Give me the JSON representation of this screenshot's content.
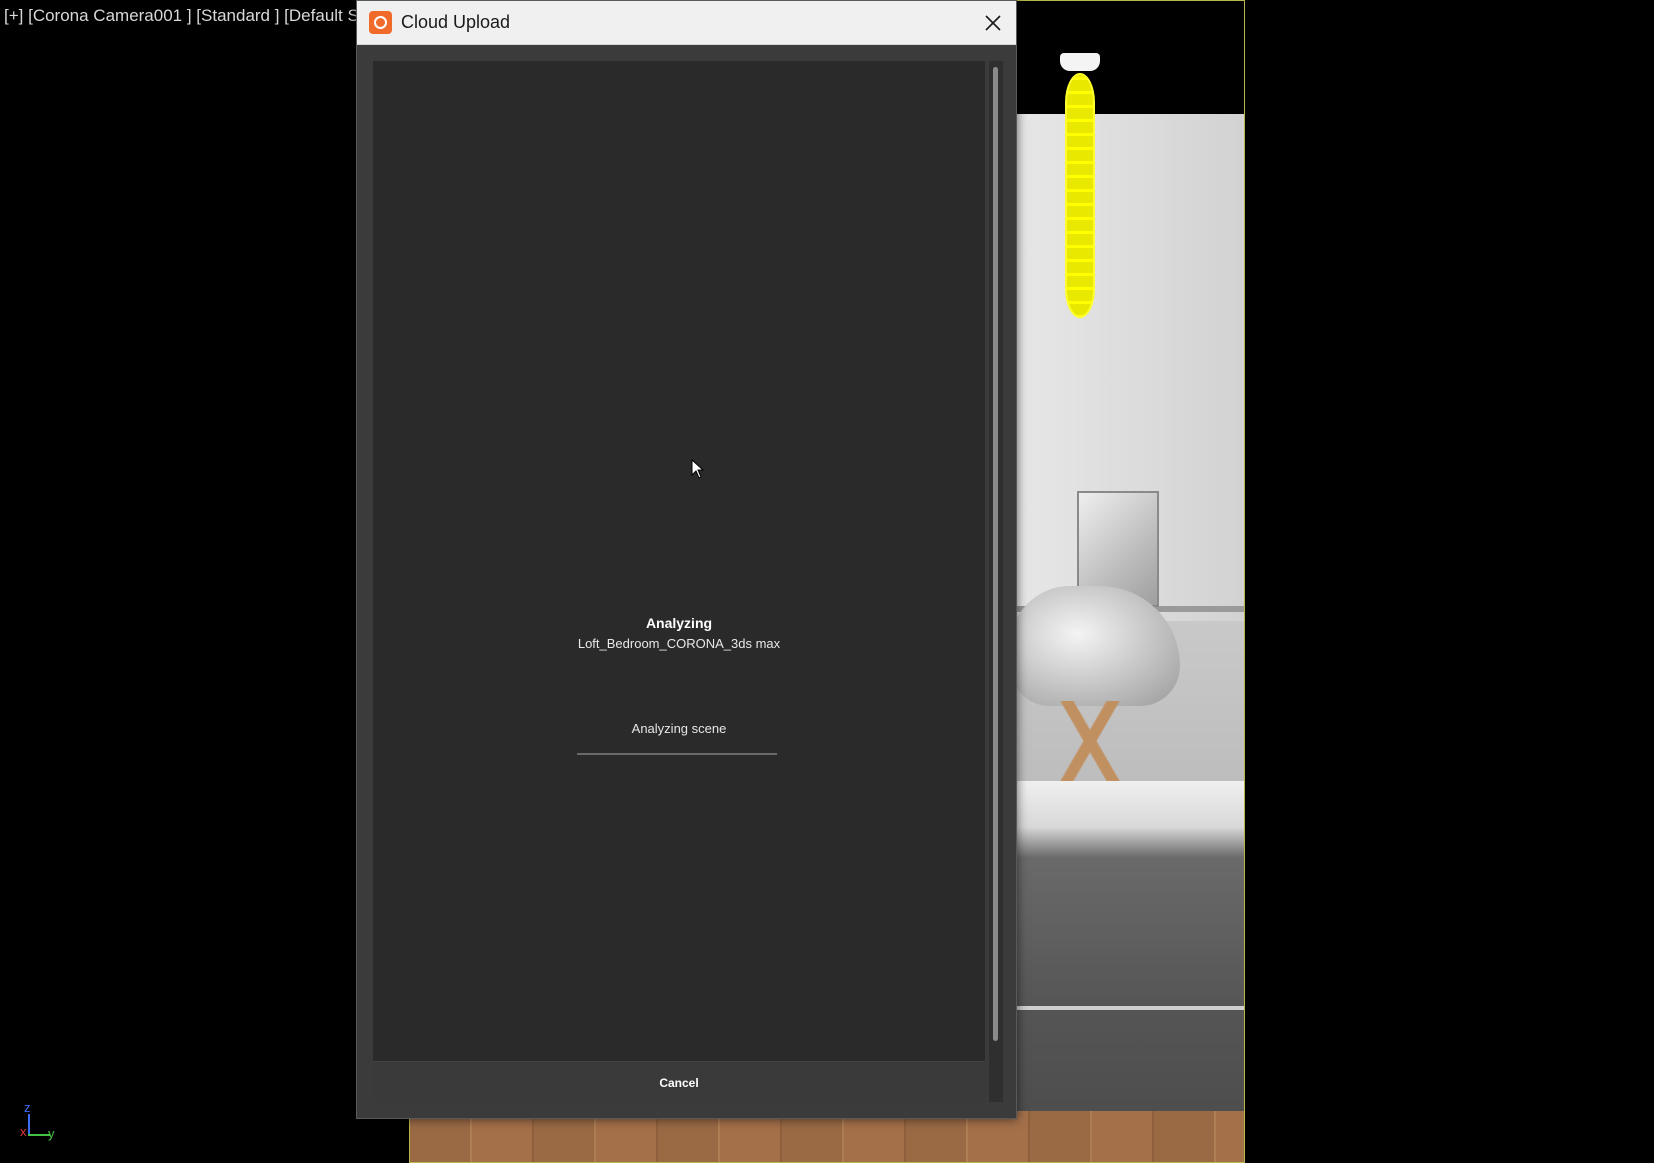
{
  "viewport": {
    "label": "[+] [Corona Camera001 ] [Standard ] [Default S"
  },
  "gizmo": {
    "z": "z",
    "x": "x",
    "y": "y"
  },
  "dialog": {
    "title": "Cloud Upload",
    "app_icon": "cloud-upload-app-icon",
    "close_icon": "close-icon",
    "status_title": "Analyzing",
    "status_file": "Loft_Bedroom_CORONA_3ds max",
    "progress_label": "Analyzing scene",
    "progress_fraction": 0.0,
    "cancel_label": "Cancel"
  },
  "colors": {
    "accent": "#f06a2a",
    "dialog_bg": "#3b3b3b",
    "panel_bg": "#2a2a2a",
    "viewport_border": "#b8b84a",
    "light_gizmo": "#ffff00"
  }
}
